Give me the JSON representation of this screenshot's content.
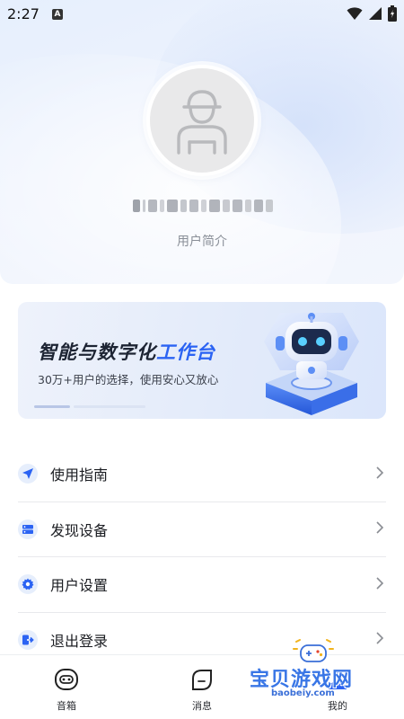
{
  "status_bar": {
    "time": "2:27",
    "notification_glyph": "A",
    "icons": [
      "wifi-icon",
      "signal-icon",
      "battery-icon"
    ]
  },
  "profile": {
    "avatar_icon": "user-placeholder-icon",
    "username": "",
    "bio": "用户简介"
  },
  "banner": {
    "title_main": "智能与数字化",
    "title_accent": "工作台",
    "subtitle": "30万+用户的选择，使用安心又放心",
    "illustration": "robot-illustration"
  },
  "menu": {
    "items": [
      {
        "label": "使用指南",
        "icon": "navigation-arrow-icon"
      },
      {
        "label": "发现设备",
        "icon": "device-list-icon"
      },
      {
        "label": "用户设置",
        "icon": "gear-icon"
      },
      {
        "label": "退出登录",
        "icon": "logout-icon"
      }
    ]
  },
  "bottom_nav": {
    "items": [
      {
        "label": "音箱",
        "icon": "speaker-icon"
      },
      {
        "label": "消息",
        "icon": "message-icon"
      },
      {
        "label": "我的",
        "icon": "user-icon"
      }
    ]
  },
  "watermark": {
    "text": "宝贝游戏网",
    "url": "baobeiy.com"
  },
  "colors": {
    "accent": "#2b63f3",
    "header_bg": "#e9f0fd",
    "divider": "#e8e9ec",
    "muted_text": "#8a8f98"
  }
}
